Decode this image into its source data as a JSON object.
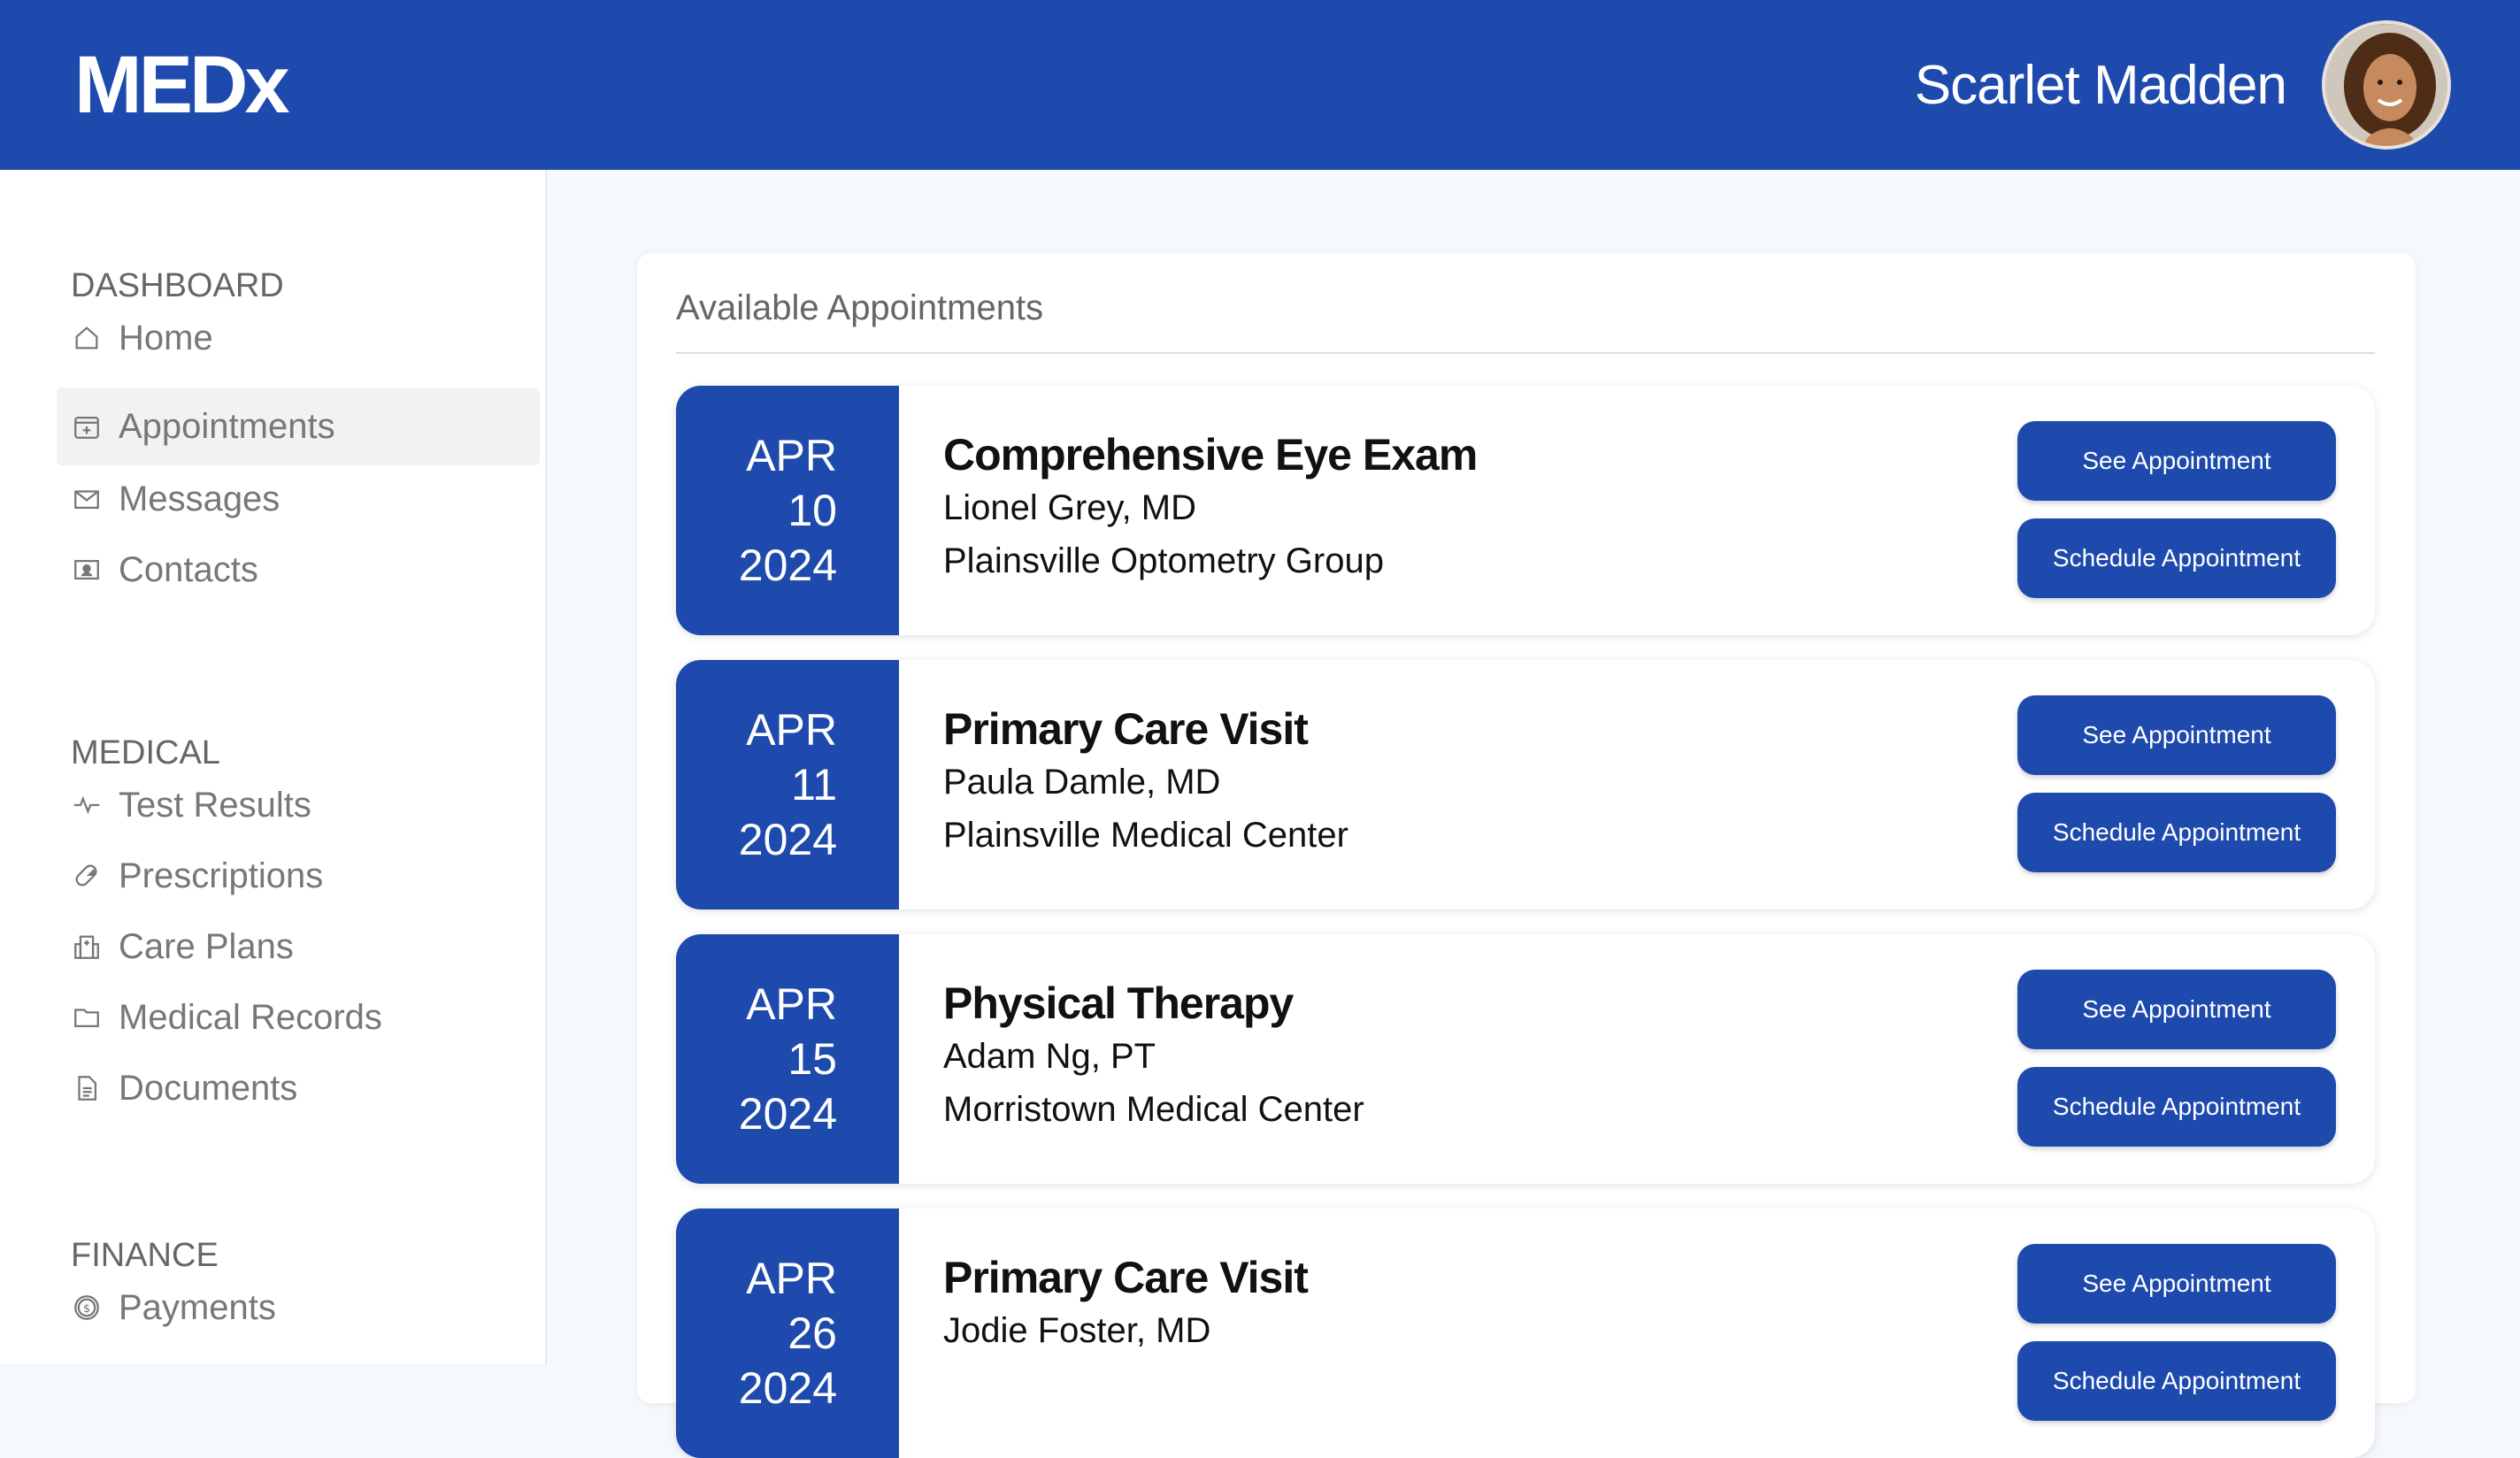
{
  "brand": {
    "logo": "MEDx",
    "primary_color": "#1e4aad"
  },
  "user": {
    "name": "Scarlet Madden",
    "avatar_icon": "user-avatar"
  },
  "sidebar": {
    "sections": [
      {
        "heading": "DASHBOARD",
        "items": [
          {
            "label": "Home",
            "icon": "home-icon",
            "active": false
          },
          {
            "label": "Appointments",
            "icon": "calendar-icon",
            "active": true
          },
          {
            "label": "Messages",
            "icon": "envelope-icon",
            "active": false
          },
          {
            "label": "Contacts",
            "icon": "contact-card-icon",
            "active": false
          }
        ]
      },
      {
        "heading": "MEDICAL",
        "items": [
          {
            "label": "Test Results",
            "icon": "pulse-icon",
            "active": false
          },
          {
            "label": "Prescriptions",
            "icon": "pill-icon",
            "active": false
          },
          {
            "label": "Care Plans",
            "icon": "hospital-icon",
            "active": false
          },
          {
            "label": "Medical Records",
            "icon": "folder-icon",
            "active": false
          },
          {
            "label": "Documents",
            "icon": "document-icon",
            "active": false
          }
        ]
      },
      {
        "heading": "FINANCE",
        "items": [
          {
            "label": "Payments",
            "icon": "dollar-coin-icon",
            "active": false
          }
        ]
      }
    ]
  },
  "main": {
    "title": "Available Appointments",
    "see_label": "See Appointment",
    "schedule_label": "Schedule Appointment",
    "appointments": [
      {
        "month": "APR",
        "day": "10",
        "year": "2024",
        "title": "Comprehensive Eye Exam",
        "provider": "Lionel Grey, MD",
        "location": "Plainsville Optometry Group"
      },
      {
        "month": "APR",
        "day": "11",
        "year": "2024",
        "title": "Primary Care Visit",
        "provider": "Paula Damle, MD",
        "location": "Plainsville Medical Center"
      },
      {
        "month": "APR",
        "day": "15",
        "year": "2024",
        "title": "Physical Therapy",
        "provider": "Adam Ng, PT",
        "location": "Morristown Medical Center"
      },
      {
        "month": "APR",
        "day": "26",
        "year": "2024",
        "title": "Primary Care Visit",
        "provider": "Jodie Foster, MD",
        "location": ""
      }
    ]
  }
}
